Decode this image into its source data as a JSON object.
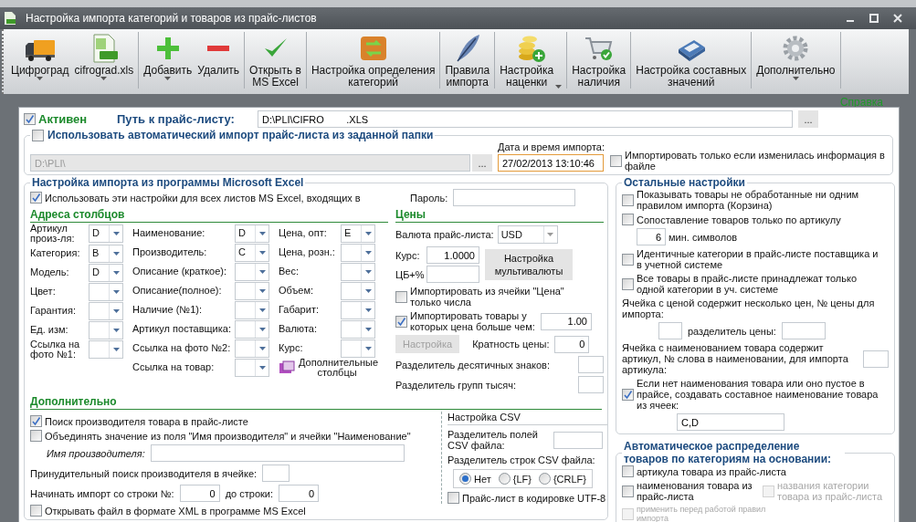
{
  "window": {
    "title": "Настройка импорта категорий и товаров из прайс-листов"
  },
  "toolbar": [
    [
      {
        "kind": "truck",
        "label": "Цифроград",
        "dropdown": true
      },
      {
        "kind": "xls",
        "label": "cifrograd.xls",
        "dropdown": true
      }
    ],
    [
      {
        "kind": "plus",
        "label": "Добавить",
        "dropdown": true
      },
      {
        "kind": "minus",
        "label": "Удалить",
        "dropdown": false
      }
    ],
    [
      {
        "kind": "check",
        "label": "Открыть в\nMS Excel",
        "dropdown": false
      }
    ],
    [
      {
        "kind": "box",
        "label": "Настройка определения\nкатегорий",
        "dropdown": false
      }
    ],
    [
      {
        "kind": "feather",
        "label": "Правила\nимпорта",
        "dropdown": false
      }
    ],
    [
      {
        "kind": "coins",
        "label": "Настройка\nнаценки",
        "dropdown_inline": true,
        "dropdown": false
      }
    ],
    [
      {
        "kind": "cart",
        "label": "Настройка\nналичия",
        "dropdown": false
      }
    ],
    [
      {
        "kind": "toolbox",
        "label": "Настройка составных\nзначений",
        "dropdown": false
      }
    ],
    [
      {
        "kind": "gear",
        "label": "Дополнительно",
        "dropdown": true
      }
    ]
  ],
  "help_link": "Справка",
  "active": {
    "label": "Активен",
    "checked": true
  },
  "path": {
    "label": "Путь к прайс-листу:",
    "value": "D:\\PLI\\CIFRO        .XLS",
    "browse": "..."
  },
  "auto_import": {
    "label": "Использовать автоматический импорт прайс-листа из заданной папки",
    "checked": false,
    "folder": "D:\\PLI\\",
    "browse": "...",
    "date_label": "Дата и время импорта:",
    "date_value": "27/02/2013 13:10:46",
    "only_changed": {
      "label": "Импортировать только если изменилась информация в файле",
      "checked": false
    }
  },
  "excel": {
    "title": "Настройка импорта из программы Microsoft Excel",
    "use_all": {
      "label": "Использовать эти настройки для всех листов MS Excel, входящих в",
      "checked": true
    },
    "password_label": "Пароль:",
    "columns_title": "Адреса столбцов",
    "column_groups": [
      [
        {
          "label": "Артикул произ-ля:",
          "value": "D"
        },
        {
          "label": "Категория:",
          "value": "B"
        },
        {
          "label": "Модель:",
          "value": "D"
        },
        {
          "label": "Цвет:"
        },
        {
          "label": "Гарантия:"
        },
        {
          "label": "Ед. изм:"
        },
        {
          "label": "Ссылка на фото №1:"
        }
      ],
      [
        {
          "label": "Наименование:",
          "value": "D"
        },
        {
          "label": "Производитель:",
          "value": "C"
        },
        {
          "label": "Описание (краткое):"
        },
        {
          "label": "Описание(полное):"
        },
        {
          "label": "Наличие (№1):"
        },
        {
          "label": "Артикул поставщика:"
        },
        {
          "label": "Ссылка на фото №2:"
        },
        {
          "label": "Ссылка на товар:"
        }
      ],
      [
        {
          "label": "Цена, опт:",
          "value": "E"
        },
        {
          "label": "Цена, розн.:"
        },
        {
          "label": "Вес:"
        },
        {
          "label": "Объем:"
        },
        {
          "label": "Габарит:"
        },
        {
          "label": "Валюта:"
        },
        {
          "label": "Курс:"
        }
      ]
    ],
    "extra_columns": "Дополнительные столбцы",
    "prices": {
      "title": "Цены",
      "currency_label": "Валюта прайс-листа:",
      "currency": "USD",
      "rate_label": "Курс:",
      "rate": "1.0000",
      "cb_label": "ЦБ+%",
      "multicurrency": "Настройка мультивалюты",
      "only_numbers": {
        "label": "Импортировать из ячейки \"Цена\" только числа",
        "checked": false
      },
      "min_price": {
        "label": "Импортировать товары у которых цена больше чем:",
        "checked": true,
        "value": "1.00"
      },
      "settings": {
        "label": "Настройка",
        "disabled": true
      },
      "multiplicity_label": "Кратность цены:",
      "multiplicity": "0",
      "decimal_label": "Разделитель десятичных знаков:",
      "thousands_label": "Разделитель групп тысяч:"
    },
    "extra": {
      "title": "Дополнительно",
      "find_manufacturer": {
        "label": "Поиск производителя товара в прайс-листе",
        "checked": true
      },
      "merge": {
        "label": "Объединять значение из поля \"Имя производителя\" и ячейки \"Наименование\"",
        "checked": false
      },
      "manufacturer_label": "Имя производителя:",
      "forced_label": "Принудительный поиск производителя в ячейке:",
      "start_label": "Начинать импорт со строки №:",
      "start": "0",
      "end_label": "до строки:",
      "end": "0",
      "open_xml": {
        "label": "Открывать файл в формате XML в программе MS Excel",
        "checked": false
      }
    },
    "csv": {
      "title": "Настройка CSV",
      "field_sep_label": "Разделитель полей CSV файла:",
      "row_sep_label": "Разделитель строк CSV файла:",
      "row_sep": [
        {
          "label": "Нет",
          "selected": true
        },
        {
          "label": "{LF}",
          "selected": false
        },
        {
          "label": "{CRLF}",
          "selected": false
        }
      ],
      "utf8": {
        "label": "Прайс-лист в кодировке UTF-8",
        "checked": false
      }
    }
  },
  "other": {
    "title": "Остальные настройки",
    "basket": {
      "label": "Показывать товары не обработанные ни одним правилом импорта (Корзина)",
      "checked": false
    },
    "by_article": {
      "label": "Сопоставление товаров только по артикулу",
      "checked": false
    },
    "min_chars": "6",
    "min_chars_label": "мин. символов",
    "identical": {
      "label": "Идентичные категории в прайс-листе поставщика и в учетной системе",
      "checked": false
    },
    "single": {
      "label": "Все товары в прайс-листе принадлежат только одной категории в уч. системе",
      "checked": false
    },
    "multi_price_label": "Ячейка с ценой содержит несколько цен, № цены для импорта:",
    "price_sep_label": "разделитель цены:",
    "article_label": "Ячейка с наименованием товара содержит артикул, № слова в наименовании, для импорта артикула:",
    "composite": {
      "label": "Если нет наименования товара или оно пустое в прайсе, создавать составное наименование товара из ячеек:",
      "checked": true,
      "value": "C,D"
    }
  },
  "auto_dist": {
    "title": "Автоматическое распределение товаров по категориям на основании:",
    "by_article": {
      "label": "артикула товара из прайс-листа",
      "checked": false
    },
    "by_name": {
      "label": "наименования товара из прайс-листа",
      "checked": false
    },
    "by_category": {
      "label": "названия  категории товара из прайс-листа",
      "checked": false,
      "disabled": true
    },
    "before_rules": {
      "label": "применить перед работой правил импорта",
      "checked": false,
      "disabled": true
    }
  }
}
